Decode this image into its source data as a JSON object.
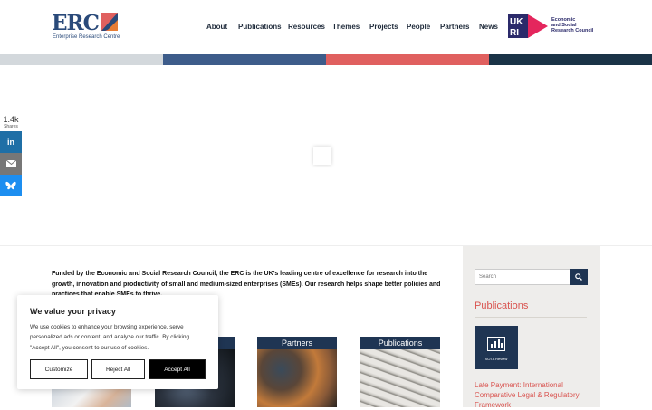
{
  "header": {
    "logo_text": "ERC",
    "logo_subtitle": "Enterprise Research Centre",
    "nav": [
      {
        "label": "About"
      },
      {
        "label": "Publications"
      },
      {
        "label": "Resources"
      },
      {
        "label": "Themes"
      },
      {
        "label": "Projects"
      },
      {
        "label": "People"
      },
      {
        "label": "Partners"
      },
      {
        "label": "News"
      }
    ],
    "partner_logo_mark": "UKRI",
    "partner_logo_lines": [
      "Economic",
      "and Social",
      "Research Council"
    ]
  },
  "stripes": [
    "#d3d8dc",
    "#3d5c8a",
    "#e0605f",
    "#1a3347"
  ],
  "share": {
    "count": "1.4k",
    "label": "Shares",
    "buttons": [
      {
        "icon": "linkedin-icon",
        "color": "#1f6fa6"
      },
      {
        "icon": "email-icon",
        "color": "#777777"
      },
      {
        "icon": "bluesky-icon",
        "color": "#1d8ef0"
      }
    ]
  },
  "intro": {
    "text": "Funded by the Economic and Social Research Council, the ERC is the UK’s leading centre of excellence for research into the growth, innovation and productivity of small and medium-sized enterprises (SMEs). Our research helps shape better policies and practices that enable SMEs to thrive."
  },
  "sidebar": {
    "search_placeholder": "Search",
    "publications_heading": "Publications",
    "featured_badge": "SOTA Review",
    "featured_title": "Late Payment: International Comparative Legal & Regulatory Framework"
  },
  "tiles": [
    {
      "label": ""
    },
    {
      "label": ""
    },
    {
      "label": "Partners"
    },
    {
      "label": "Publications"
    }
  ],
  "cookie": {
    "title": "We value your privacy",
    "body": "We use cookies to enhance your browsing experience, serve personalized ads or content, and analyze our traffic. By clicking \"Accept All\", you consent to our use of cookies.",
    "customize": "Customize",
    "reject": "Reject All",
    "accept": "Accept All"
  },
  "colors": {
    "navy": "#1f3553",
    "accent": "#d9534f",
    "sidebar_bg": "#eeedeb"
  }
}
